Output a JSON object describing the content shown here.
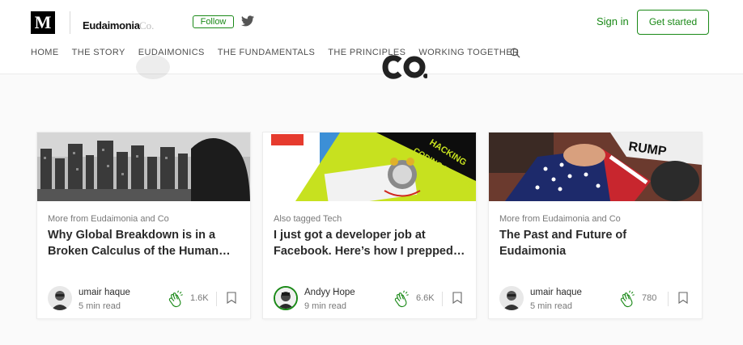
{
  "header": {
    "logo": "M",
    "publication": {
      "name": "Eudaimonia",
      "suffix": "Co."
    },
    "follow_label": "Follow",
    "signin_label": "Sign in",
    "get_started_label": "Get started",
    "nav": [
      "HOME",
      "THE STORY",
      "EUDAIMONICS",
      "THE FUNDAMENTALS",
      "THE PRINCIPLES",
      "WORKING TOGETHER"
    ],
    "icons": {
      "twitter": "twitter-icon",
      "search": "search-icon"
    }
  },
  "colors": {
    "accent": "#1a8917",
    "twitter": "#555555",
    "background": "#fafafa"
  },
  "cards": [
    {
      "kicker": "More from Eudaimonia and Co",
      "title": "Why Global Breakdown is in a Broken Calculus of the Human…",
      "author": "umair haque",
      "read_time": "5 min read",
      "claps": "1.6K"
    },
    {
      "kicker": "Also tagged Tech",
      "title": "I just got a developer job at Facebook. Here’s how I prepped…",
      "author": "Andyy Hope",
      "read_time": "9 min read",
      "claps": "6.6K"
    },
    {
      "kicker": "More from Eudaimonia and Co",
      "title": "The Past and Future of Eudaimonia",
      "author": "umair haque",
      "read_time": "5 min read",
      "claps": "780"
    }
  ]
}
